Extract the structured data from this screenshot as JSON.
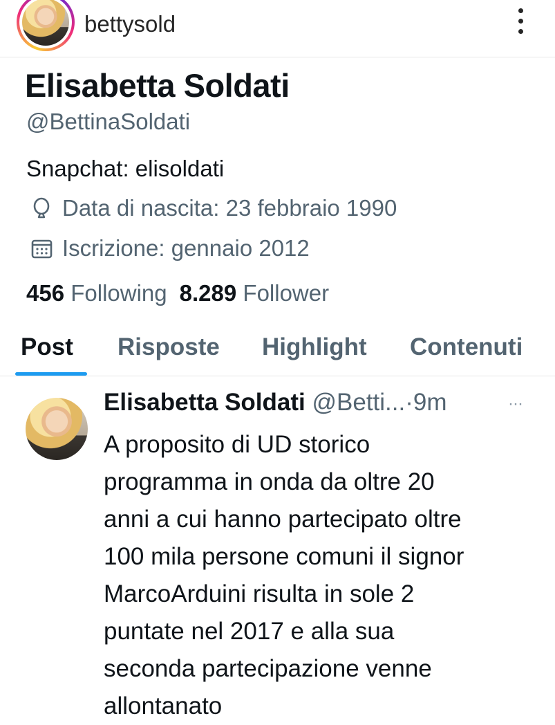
{
  "header": {
    "username": "bettysold",
    "menu_icon": "more-vertical-icon"
  },
  "profile": {
    "display_name": "Elisabetta Soldati",
    "handle": "@BettinaSoldati",
    "bio": "Snapchat: elisoldati",
    "birth": "Data di nascita: 23 febbraio 1990",
    "birth_icon": "balloon-icon",
    "joined": "Iscrizione: gennaio 2012",
    "joined_icon": "calendar-icon",
    "following_count": "456",
    "following_label": "Following",
    "follower_count": "8.289",
    "follower_label": "Follower"
  },
  "tabs": [
    {
      "label": "Post",
      "active": true
    },
    {
      "label": "Risposte",
      "active": false
    },
    {
      "label": "Highlight",
      "active": false
    },
    {
      "label": "Contenuti",
      "active": false
    }
  ],
  "post": {
    "author": "Elisabetta Soldati",
    "handle_truncated": "@Betti...",
    "separator": "·",
    "time": "9m",
    "more": "···",
    "lines": [
      "A proposito di UD storico",
      "programma in onda da oltre 20",
      "anni a cui hanno partecipato oltre",
      "100 mila persone comuni il signor",
      "MarcoArduini risulta in sole 2",
      "puntate nel 2017 e alla sua",
      "seconda partecipazione venne",
      "allontanato"
    ]
  },
  "colors": {
    "accent": "#1d9bf0",
    "text_primary": "#0f1419",
    "text_secondary": "#536471"
  }
}
